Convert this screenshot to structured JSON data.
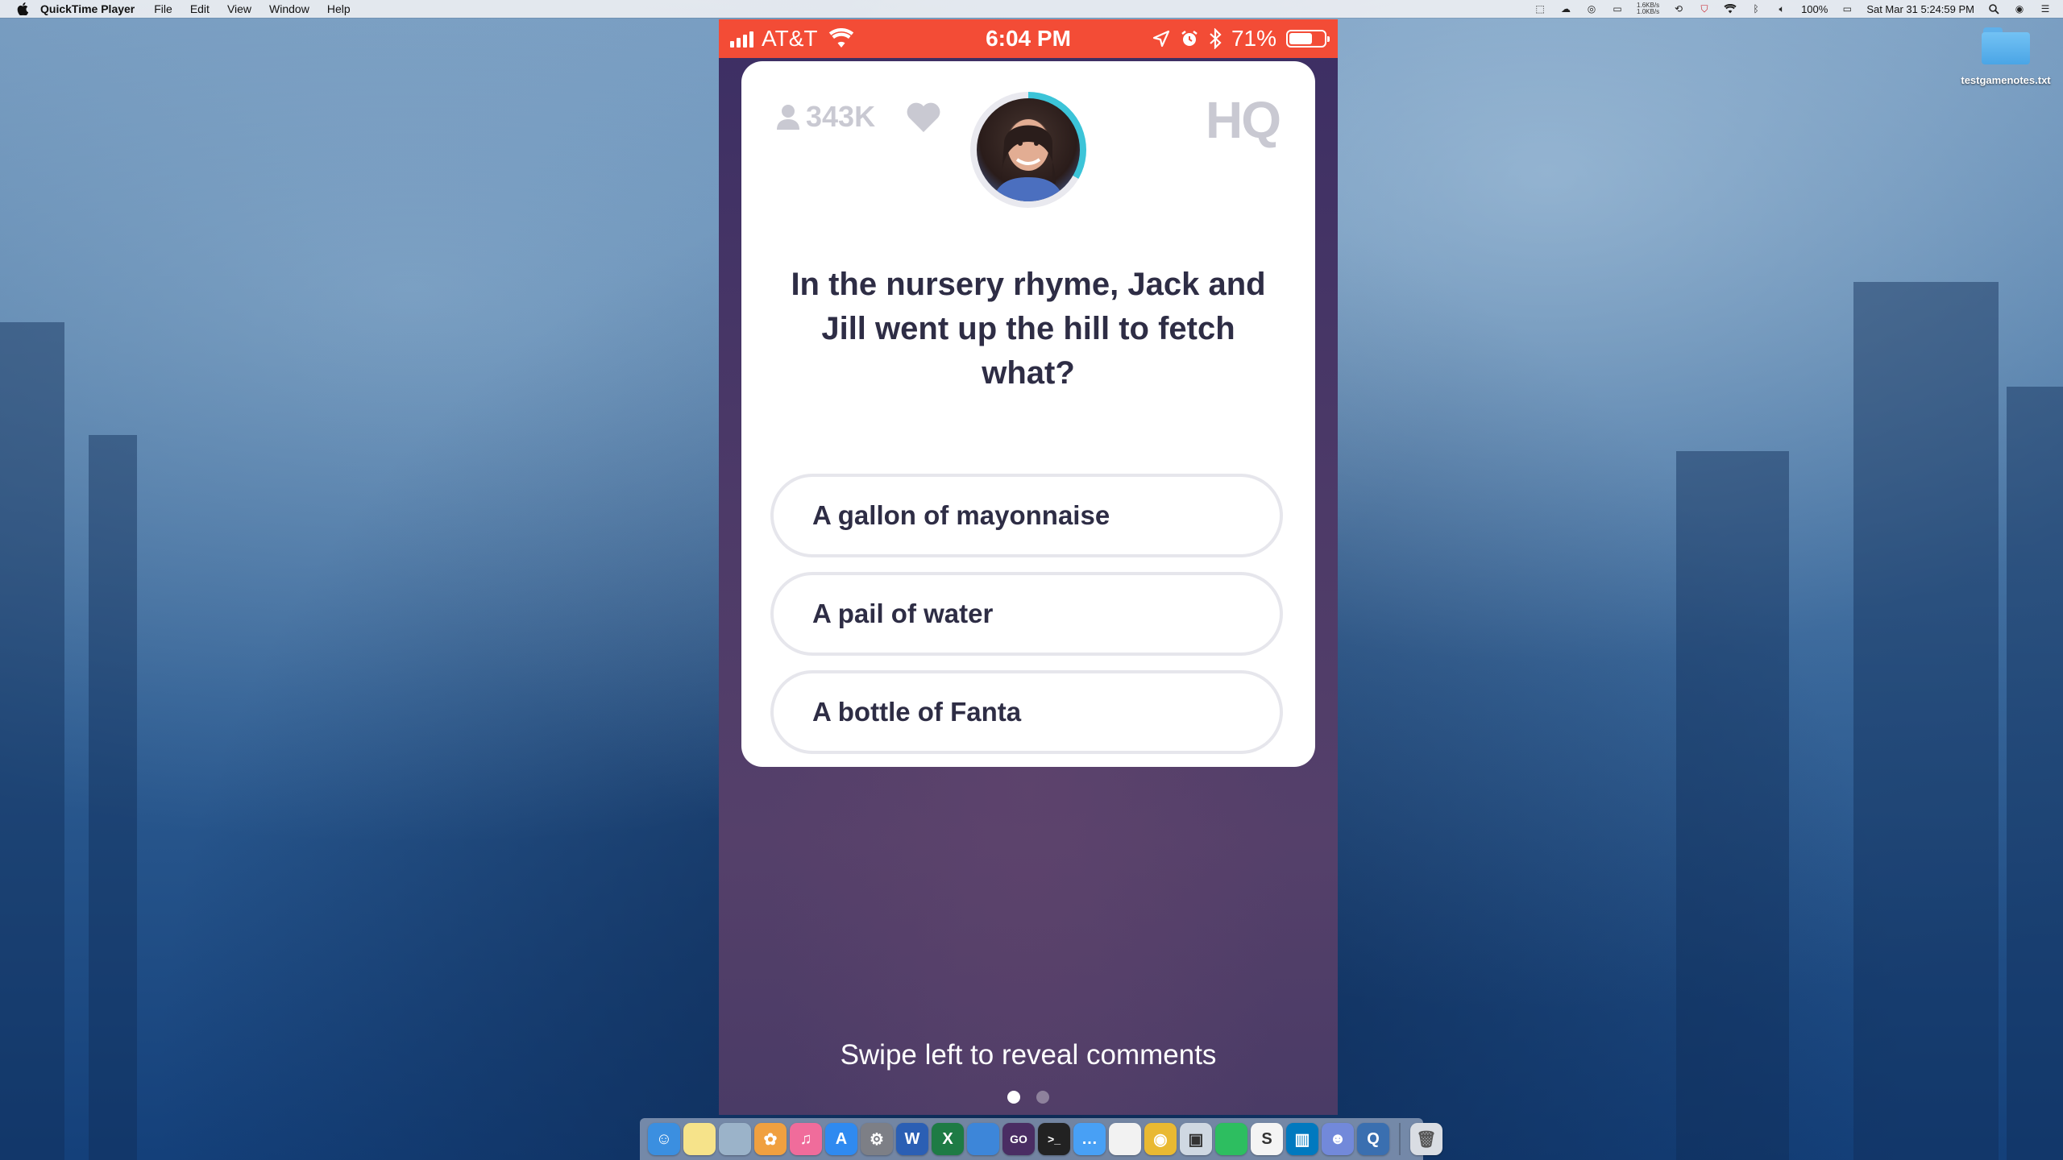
{
  "menubar": {
    "app_name": "QuickTime Player",
    "menus": [
      "File",
      "Edit",
      "View",
      "Window",
      "Help"
    ],
    "net_up": "1.6KB/s",
    "net_down": "1.0KB/s",
    "battery": "100%",
    "clock": "Sat Mar 31  5:24:59 PM"
  },
  "desktop": {
    "file_label": "testgamenotes.txt"
  },
  "phone": {
    "carrier": "AT&T",
    "time": "6:04 PM",
    "battery_percent": "71%",
    "battery_level": 0.71,
    "viewer_count": "343K",
    "logo": "HQ",
    "question": "In the nursery rhyme, Jack and Jill went up the hill to fetch what?",
    "answers": [
      "A gallon of mayonnaise",
      "A pail of water",
      "A bottle of Fanta"
    ],
    "swipe_hint": "Swipe left to reveal comments",
    "page_dots": 2,
    "active_dot": 0
  },
  "colors": {
    "status_bar": "#f34c36",
    "phone_bg": "#4a3b66",
    "text_dark": "#2e2d45",
    "muted": "#c9c9d2",
    "timer_ring": "#3cc4d8"
  },
  "dock": {
    "apps": [
      {
        "name": "finder-icon",
        "color": "#3b8fe0",
        "glyph": "☺"
      },
      {
        "name": "notes-icon",
        "color": "#f6e38a",
        "glyph": ""
      },
      {
        "name": "preview-icon",
        "color": "#9bb3c9",
        "glyph": ""
      },
      {
        "name": "photos-icon",
        "color": "#f0a040",
        "glyph": "✿"
      },
      {
        "name": "itunes-icon",
        "color": "#f06c9b",
        "glyph": "♫"
      },
      {
        "name": "app-store-icon",
        "color": "#2f8af0",
        "glyph": "A"
      },
      {
        "name": "system-preferences-icon",
        "color": "#7d7f86",
        "glyph": "⚙"
      },
      {
        "name": "word-icon",
        "color": "#2b5fb4",
        "glyph": "W"
      },
      {
        "name": "excel-icon",
        "color": "#1e7b45",
        "glyph": "X"
      },
      {
        "name": "xcode-icon",
        "color": "#3d86d9",
        "glyph": ""
      },
      {
        "name": "gog-icon",
        "color": "#4a2d63",
        "glyph": "GO"
      },
      {
        "name": "terminal-icon",
        "color": "#222222",
        "glyph": ">_"
      },
      {
        "name": "messages-icon",
        "color": "#48a0f5",
        "glyph": "…"
      },
      {
        "name": "calendar-icon",
        "color": "#f2f2f2",
        "glyph": ""
      },
      {
        "name": "chrome-icon",
        "color": "#e9b932",
        "glyph": "◉"
      },
      {
        "name": "virtualbox-icon",
        "color": "#cfd8e2",
        "glyph": "▣"
      },
      {
        "name": "evernote-icon",
        "color": "#2dbe60",
        "glyph": ""
      },
      {
        "name": "scrivener-icon",
        "color": "#f4f4f4",
        "glyph": "S"
      },
      {
        "name": "trello-icon",
        "color": "#0079bf",
        "glyph": "▥"
      },
      {
        "name": "discord-icon",
        "color": "#7289da",
        "glyph": "☻"
      },
      {
        "name": "quicktime-icon",
        "color": "#3a6fb0",
        "glyph": "Q"
      }
    ],
    "trash": {
      "name": "trash-icon",
      "color": "#d9dde3",
      "glyph": "🗑"
    }
  }
}
